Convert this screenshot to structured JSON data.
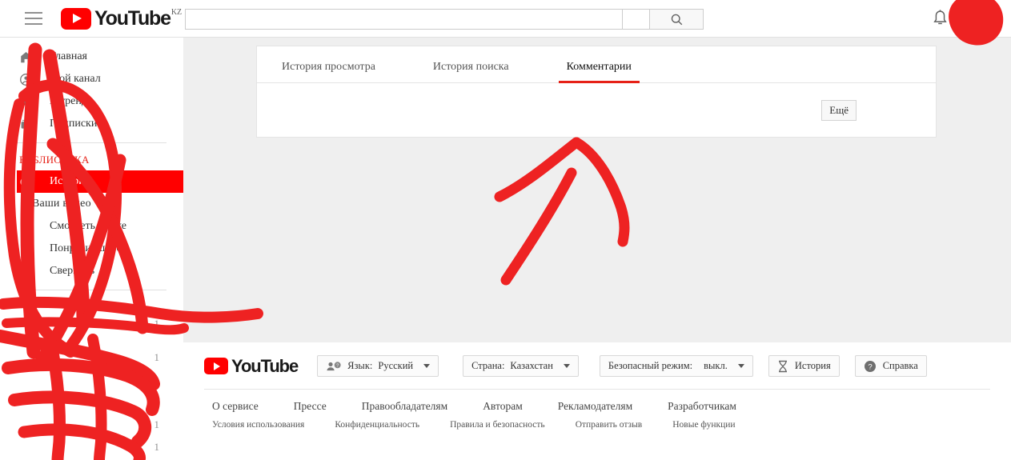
{
  "header": {
    "menu_icon": "hamburger-menu-icon",
    "logo_text": "YouTube",
    "logo_country_suffix": "KZ",
    "search": {
      "value": "",
      "placeholder": "",
      "button_icon": "search-icon"
    },
    "notifications_icon": "bell-icon",
    "avatar_label": ""
  },
  "sidebar": {
    "nav": [
      {
        "label": "Главная",
        "icon": "home-icon",
        "active": false
      },
      {
        "label": "Мой канал",
        "icon": "account-circle-icon",
        "active": false
      },
      {
        "label": "В тренде",
        "icon": "trending-icon",
        "active": false
      },
      {
        "label": "Подписки",
        "icon": "subscriptions-icon",
        "active": false
      }
    ],
    "library_heading": "БИБЛИОТЕКА",
    "library": [
      {
        "label": "История",
        "icon": "history-icon",
        "active": true
      },
      {
        "label": "Ваши видео",
        "icon": "your-videos-icon",
        "active": false
      },
      {
        "label": "Смотреть позже",
        "icon": "watch-later-icon",
        "active": false
      },
      {
        "label": "Понравившиеся",
        "icon": "thumbs-up-icon",
        "active": false
      },
      {
        "label": "Свернуть",
        "icon": "collapse-icon",
        "active": false
      }
    ],
    "subscription_rows": [
      {
        "name": "",
        "count": "1"
      },
      {
        "name": "",
        "count": "1"
      },
      {
        "name": "",
        "count": "1"
      },
      {
        "name": "",
        "count": "1"
      },
      {
        "name": "",
        "count": "1"
      },
      {
        "name": "",
        "count": "1"
      }
    ]
  },
  "main": {
    "tabs": [
      {
        "label": "История просмотра",
        "active": false
      },
      {
        "label": "История поиска",
        "active": false
      },
      {
        "label": "Комментарии",
        "active": true
      }
    ],
    "more_button": "Ещё"
  },
  "footer": {
    "logo_text": "YouTube",
    "controls": [
      {
        "name": "language",
        "icon": "person-help-icon",
        "caption": "Язык:",
        "value": "Русский",
        "caret": true
      },
      {
        "name": "country",
        "icon": "",
        "caption": "Страна:",
        "value": "Казахстан",
        "caret": true
      },
      {
        "name": "restricted-mode",
        "icon": "",
        "caption": "Безопасный режим:",
        "value": "выкл.",
        "caret": true
      },
      {
        "name": "history",
        "icon": "hourglass-icon",
        "caption": "История",
        "value": "",
        "caret": false
      },
      {
        "name": "help",
        "icon": "question-circle-icon",
        "caption": "Справка",
        "value": "",
        "caret": false
      }
    ],
    "links_primary": [
      "О сервисе",
      "Прессе",
      "Правообладателям",
      "Авторам",
      "Рекламодателям",
      "Разработчикам"
    ],
    "links_secondary": [
      "Условия использования",
      "Конфиденциальность",
      "Правила и безопасность",
      "Отправить отзыв",
      "Новые функции"
    ]
  },
  "annotations": {
    "ink_color": "#ee2222",
    "marks": [
      "avatar-scribble",
      "sidebar-scribble",
      "arrow-pointing-up-right"
    ]
  },
  "colors": {
    "brand_red": "#ff0000",
    "accent_red": "#e62117",
    "page_bg": "#efefef",
    "panel_bg": "#ffffff",
    "text": "#333333",
    "muted": "#909090",
    "ink": "#ee2222"
  }
}
